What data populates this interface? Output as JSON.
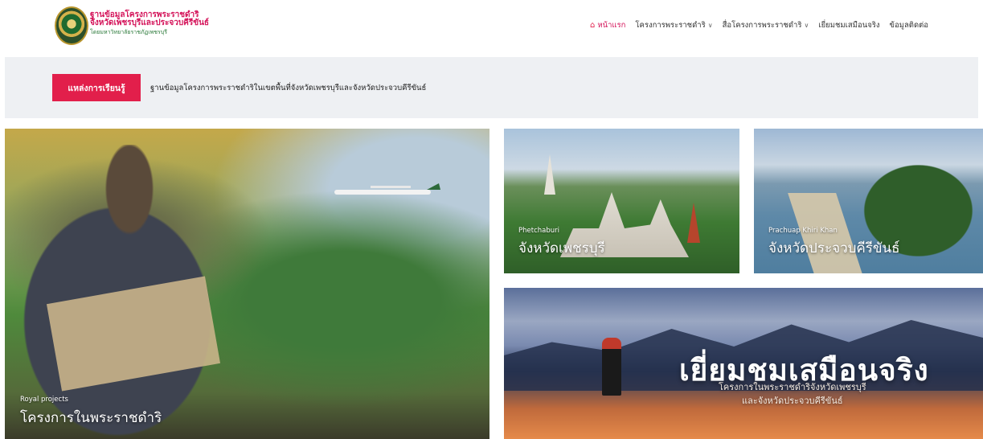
{
  "header": {
    "brand_line1": "ฐานข้อมูลโครงการพระราชดำริ",
    "brand_line2": "จังหวัดเพชรบุรีและประจวบคีรีขันธ์",
    "brand_line3": "โดยมหาวิทยาลัยราชภัฏเพชรบุรี"
  },
  "nav": {
    "items": [
      {
        "label": "หน้าแรก",
        "icon": "home-icon",
        "active": true
      },
      {
        "label": "โครงการพระราชดำริ",
        "dropdown": true
      },
      {
        "label": "สื่อโครงการพระราชดำริ",
        "dropdown": true
      },
      {
        "label": "เยี่ยมชมเสมือนจริง"
      },
      {
        "label": "ข้อมูลติดต่อ"
      }
    ]
  },
  "ticker": {
    "button_label": "แหล่งการเรียนรู้",
    "text": "ฐานข้อมูลโครงการพระราชดำริในเขตพื้นที่จังหวัดเพชรบุรีและจังหวัดประจวบคีรีขันธ์"
  },
  "cards": {
    "royal": {
      "subtitle": "Royal projects",
      "title": "โครงการในพระราชดำริ"
    },
    "phetchaburi": {
      "subtitle": "Phetchaburi",
      "title": "จังหวัดเพชรบุรี"
    },
    "prachuap": {
      "subtitle": "Prachuap Khiri Khan",
      "title": "จังหวัดประจวบคีรีขันธ์"
    },
    "visit": {
      "title": "เยี่ยมชมเสมือนจริง",
      "subtitle_line1": "โครงการในพระราชดำริจังหวัดเพชรบุรี",
      "subtitle_line2": "และจังหวัดประจวบคีรีขันธ์"
    }
  },
  "colors": {
    "accent": "#e21f4b",
    "brand_pink": "#d4145a",
    "ticker_bg": "#eef0f3"
  }
}
